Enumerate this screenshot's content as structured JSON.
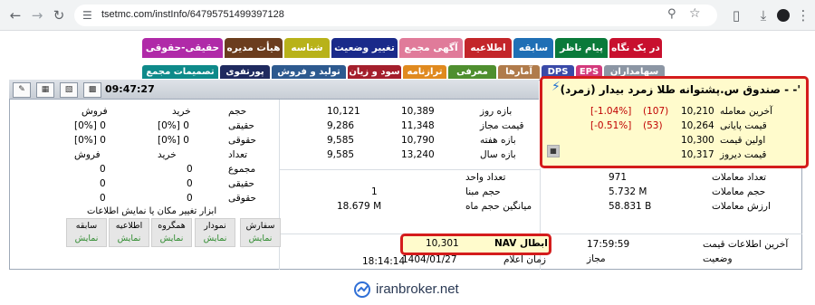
{
  "browser": {
    "url": "tsetmc.com/instInfo/64795751499397128"
  },
  "tabs_row1": [
    {
      "label": "در یک نگاه",
      "color": "#c8102e"
    },
    {
      "label": "پیام ناظر",
      "color": "#0a7a3a"
    },
    {
      "label": "سابقه",
      "color": "#1f6fb5"
    },
    {
      "label": "اطلاعیه",
      "color": "#c3262a"
    },
    {
      "label": "آگهی مجمع",
      "color": "#e07b9a"
    },
    {
      "label": "تغییر وضعیت",
      "color": "#1a2a8a"
    },
    {
      "label": "شناسه",
      "color": "#b8b21a"
    },
    {
      "label": "هیأت مدیره",
      "color": "#6b3d1e"
    },
    {
      "label": "حقیقی-حقوقی",
      "color": "#b02aa8"
    }
  ],
  "tabs_row2": [
    {
      "label": "سهامداران",
      "color": "#8c96a4"
    },
    {
      "label": "EPS",
      "color": "#d33a7c"
    },
    {
      "label": "DPS",
      "color": "#3a4aa8"
    },
    {
      "label": "آمارها",
      "color": "#b07b4b"
    },
    {
      "label": "معرفی",
      "color": "#4f8f2f"
    },
    {
      "label": "ترازنامه",
      "color": "#e08a1f"
    },
    {
      "label": "سود و زیان",
      "color": "#a41f2c"
    },
    {
      "label": "تولید و فروش",
      "color": "#2d5a8f"
    },
    {
      "label": "پورتفوی",
      "color": "#1f2a5f"
    },
    {
      "label": "تصمیمات مجمع",
      "color": "#0e8a8a"
    }
  ],
  "header": {
    "time": "09:47:27",
    "title": "صندوق س.پشتوانه طلا زمرد بیدار (زمرد) - -'"
  },
  "price_info": [
    {
      "label": "آخرین معامله",
      "value": "10,210",
      "change": "(107)",
      "percent": "[-1.04%]"
    },
    {
      "label": "قیمت پایانی",
      "value": "10,264",
      "change": "(53)",
      "percent": "[-0.51%]"
    },
    {
      "label": "اولین قیمت",
      "value": "10,300",
      "change": "",
      "percent": ""
    },
    {
      "label": "قیمت دیروز",
      "value": "10,317",
      "change": "",
      "percent": ""
    }
  ],
  "trade_stats": [
    {
      "label": "تعداد معاملات",
      "value": "971"
    },
    {
      "label": "حجم معاملات",
      "value": "5.732 M"
    },
    {
      "label": "ارزش معاملات",
      "value": "58.831 B"
    }
  ],
  "last_info": [
    {
      "label": "آخرین اطلاعات قیمت",
      "value": "17:59:59"
    },
    {
      "label": "وضعیت",
      "value": "مجاز"
    }
  ],
  "ranges": [
    {
      "label": "بازه روز",
      "low": "10,389",
      "high": "10,121"
    },
    {
      "label": "قیمت مجاز",
      "low": "11,348",
      "high": "9,286"
    },
    {
      "label": "بازه هفته",
      "low": "10,790",
      "high": "9,585"
    },
    {
      "label": "بازه سال",
      "low": "13,240",
      "high": "9,585"
    }
  ],
  "unit_info": [
    {
      "label": "تعداد واحد",
      "value": ""
    },
    {
      "label": "حجم مبنا",
      "value": "1"
    },
    {
      "label": "میانگین حجم ماه",
      "value": "18.679 M"
    }
  ],
  "nav": {
    "label": "NAV ابطال",
    "value": "10,301"
  },
  "announce": {
    "label": "زمان اعلام",
    "date": "1404/01/27",
    "time": "18:14:14"
  },
  "trader_table": {
    "header": [
      "حجم",
      "خرید",
      "فروش"
    ],
    "rows": [
      {
        "label": "حقیقی",
        "buy": "[0%] 0",
        "sell": "[0%] 0"
      },
      {
        "label": "حقوقی",
        "buy": "[0%] 0",
        "sell": "[0%] 0"
      },
      {
        "label": "تعداد",
        "buy": "خرید",
        "sell": "فروش"
      },
      {
        "label": "مجموع",
        "buy": "0",
        "sell": "0"
      },
      {
        "label": "حقیقی",
        "buy": "0",
        "sell": "0"
      },
      {
        "label": "حقوقی",
        "buy": "0",
        "sell": "0"
      }
    ]
  },
  "tools": {
    "title": "ابزار تغییر مکان یا نمایش اطلاعات",
    "buttons": [
      {
        "label": "سفارش",
        "action": "نمایش"
      },
      {
        "label": "نمودار",
        "action": "نمایش"
      },
      {
        "label": "همگروه",
        "action": "نمایش"
      },
      {
        "label": "اطلاعیه",
        "action": "نمایش"
      },
      {
        "label": "سابقه",
        "action": "نمایش"
      }
    ]
  },
  "branding": {
    "site": "iranbroker.net",
    "color": "#2b3a55"
  }
}
